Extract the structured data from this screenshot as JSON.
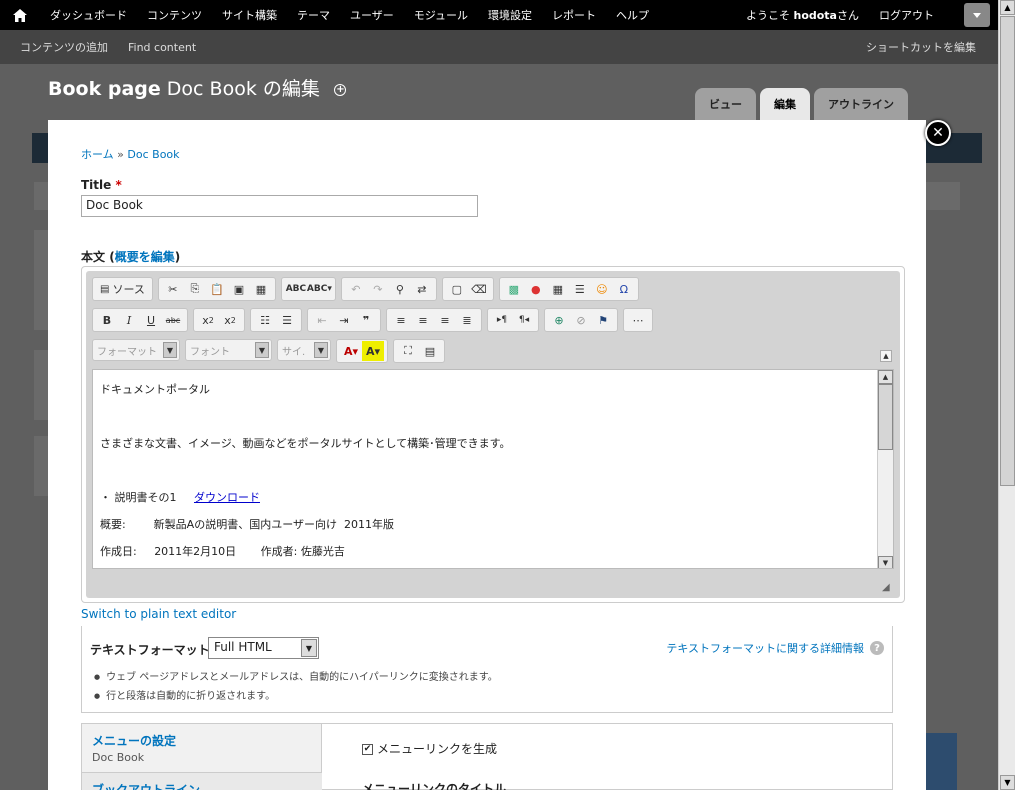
{
  "toolbar": {
    "menu": [
      "ダッシュボード",
      "コンテンツ",
      "サイト構築",
      "テーマ",
      "ユーザー",
      "モジュール",
      "環境設定",
      "レポート",
      "ヘルプ"
    ],
    "welcome": "ようこそ",
    "username": "hodota",
    "honorific": "さん",
    "logout": "ログアウト"
  },
  "shortcuts": {
    "items": [
      "コンテンツの追加",
      "Find content"
    ],
    "edit": "ショートカットを編集"
  },
  "page": {
    "title_bold": "Book page",
    "title_rest": " Doc Book の編集",
    "tabs": [
      "ビュー",
      "編集",
      "アウトライン"
    ],
    "active_tab": "編集"
  },
  "breadcrumb": {
    "home": "ホーム",
    "sep": " » ",
    "current": "Doc Book"
  },
  "form": {
    "title_label": "Title",
    "required": "*",
    "title_value": "Doc Book",
    "body_label": "本文",
    "summary_link": "概要を編集"
  },
  "editor": {
    "source_label": "ソース",
    "format_placeholder": "フォーマット",
    "font_placeholder": "フォント",
    "size_placeholder": "サイ.",
    "lines": [
      "ドキュメントポータル",
      "さまざまな文書、イメージ、動画などをポータルサイトとして構築･管理できます。",
      "・ 説明書その1",
      "ダウンロード",
      "概要:        新製品Aの説明書、国内ユーザー向け  2011年版",
      "作成日:     2011年2月10日       作成者: 佐藤光吉"
    ]
  },
  "switch_editor": "Switch to plain text editor",
  "text_format": {
    "label": "テキストフォーマット",
    "selected": "Full HTML",
    "help": "テキストフォーマットに関する詳細情報",
    "tips": [
      "ウェブ ページアドレスとメールアドレスは、自動的にハイパーリンクに変換されます。",
      "行と段落は自動的に折り返されます。"
    ]
  },
  "vertical_tabs": {
    "menu_title": "メニューの設定",
    "menu_summary": "Doc Book",
    "book_title": "ブックアウトライン",
    "menu_checkbox": "メニューリンクを生成",
    "menu_link_title": "メニューリンクのタイトル"
  },
  "colors": {
    "link": "#0074bd",
    "toolbar_bg": "#000000",
    "shortcut_bg": "#444444"
  }
}
